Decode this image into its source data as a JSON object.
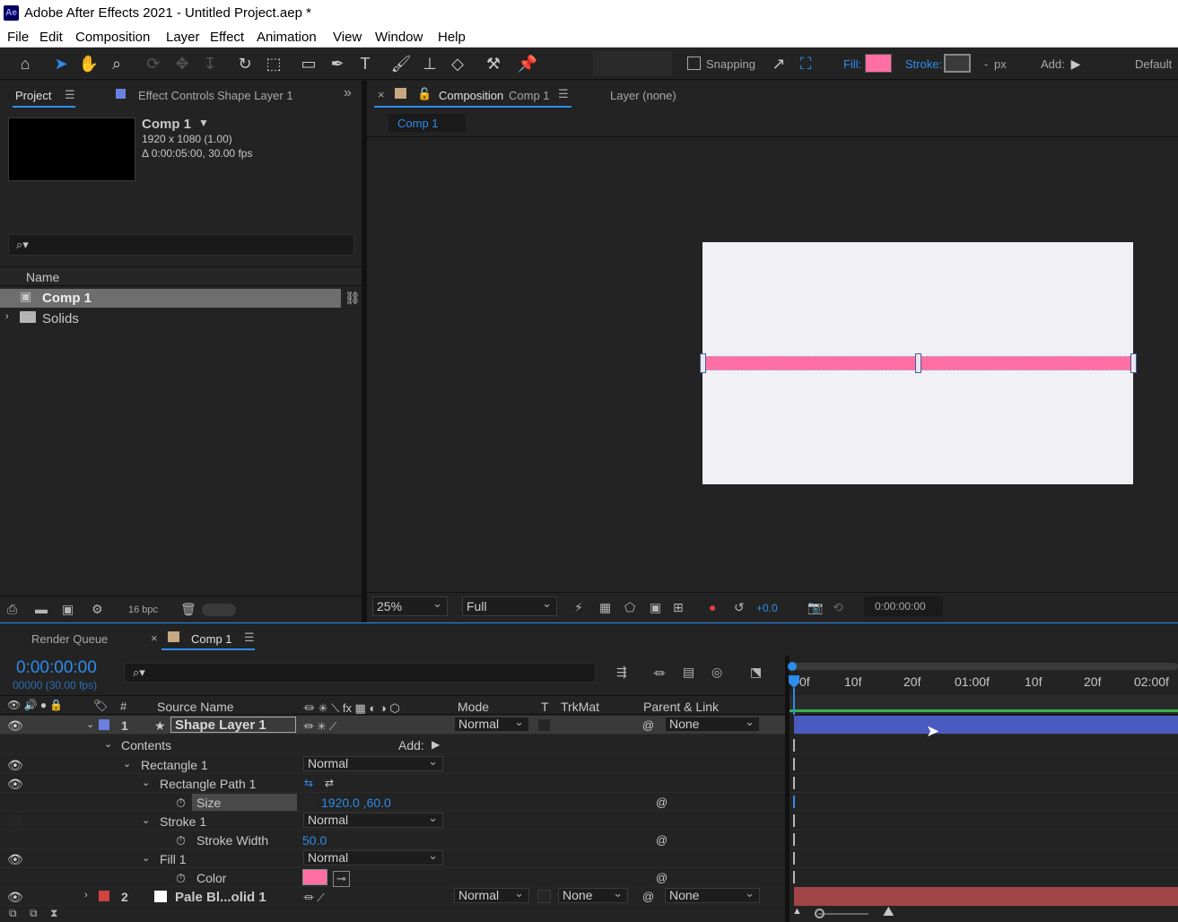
{
  "window": {
    "app_icon": "Ae",
    "title": "Adobe After Effects 2021 - Untitled Project.aep *"
  },
  "menu": [
    "File",
    "Edit",
    "Composition",
    "Layer",
    "Effect",
    "Animation",
    "View",
    "Window",
    "Help"
  ],
  "toolbar": {
    "snapping_label": "Snapping",
    "fill_label": "Fill:",
    "stroke_label": "Stroke:",
    "stroke_width": "-",
    "stroke_unit": "px",
    "add_label": "Add:",
    "workspace": "Default",
    "fill_color": "#ff6fa3"
  },
  "project_panel": {
    "tab_project": "Project",
    "tab_effect_controls": "Effect Controls",
    "effect_controls_layer": "Shape Layer 1",
    "comp_name": "Comp 1",
    "comp_size": "1920 x 1080 (1.00)",
    "comp_duration": "Δ 0:00:05:00, 30.00 fps",
    "search_placeholder": "",
    "column_name": "Name",
    "items": [
      {
        "label": "Comp 1"
      },
      {
        "label": "Solids"
      }
    ],
    "bpc": "16 bpc"
  },
  "comp_panel": {
    "tab_composition": "Composition",
    "tab_comp_name": "Comp 1",
    "layer_tab": "Layer (none)",
    "breadcrumb": "Comp 1",
    "zoom": "25%",
    "resolution": "Full",
    "exposure": "+0.0",
    "timecode": "0:00:00:00",
    "canvas_color": "#f0f0f5",
    "shape_color": "#ff6fa3"
  },
  "timeline": {
    "tab_render_queue": "Render Queue",
    "tab_comp": "Comp 1",
    "current_time": "0:00:00:00",
    "frame_info": "00000 (30.00 fps)",
    "columns": {
      "num": "#",
      "source_name": "Source Name",
      "mode": "Mode",
      "t": "T",
      "trkmat": "TrkMat",
      "parent_link": "Parent & Link"
    },
    "ruler_labels": [
      "0f",
      "10f",
      "20f",
      "01:00f",
      "10f",
      "20f",
      "02:00f"
    ],
    "layers": [
      {
        "num": "1",
        "name": "Shape Layer 1",
        "mode": "Normal",
        "parent": "None",
        "label_color": "#6a7fe0"
      },
      {
        "num": "2",
        "name": "Pale Bl...olid 1",
        "mode": "Normal",
        "trkmat": "None",
        "parent": "None",
        "label_color": "#d0423f"
      }
    ],
    "props": {
      "contents": "Contents",
      "add_label": "Add:",
      "rectangle1": "Rectangle 1",
      "rectangle1_mode": "Normal",
      "rect_path": "Rectangle Path 1",
      "size_label": "Size",
      "size_value": "1920.0 ,60.0",
      "stroke1": "Stroke 1",
      "stroke1_mode": "Normal",
      "stroke_width_label": "Stroke Width",
      "stroke_width_value": "50.0",
      "fill1": "Fill 1",
      "fill1_mode": "Normal",
      "color_label": "Color",
      "color_value": "#ff6fa3"
    }
  }
}
